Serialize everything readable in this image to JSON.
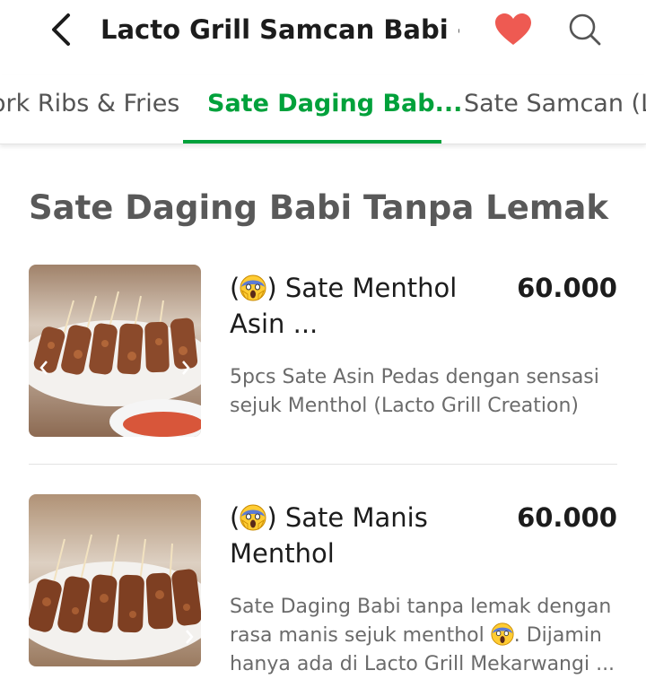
{
  "header": {
    "title": "Lacto Grill Samcan Babi -...",
    "back_icon": "chevron-left-icon",
    "favorite_icon": "heart-icon",
    "search_icon": "search-icon",
    "favorite_color": "#ee5a52"
  },
  "tabs": [
    {
      "label": "ork Ribs & Fries",
      "active": false
    },
    {
      "label": "Sate Daging Bab...",
      "active": true
    },
    {
      "label": "Sate Samcan (La",
      "active": false
    }
  ],
  "accent_color": "#00a13b",
  "section": {
    "title": "Sate Daging Babi Tanpa Lemak"
  },
  "items": [
    {
      "emoji": "screaming-face-icon",
      "open": "(",
      "close": ") ",
      "name_rest": "Sate Menthol Asin ...",
      "price": "60.000",
      "description": "5pcs Sate Asin Pedas dengan sensasi sejuk Menthol (Lacto Grill Creation)"
    },
    {
      "emoji": "screaming-face-icon",
      "open": "(",
      "close": ") ",
      "name_rest": "Sate Manis Menthol",
      "price": "60.000",
      "description_part1": "Sate Daging Babi tanpa lemak dengan rasa manis sejuk menthol ",
      "description_part2": ".  Dijamin hanya ada di Lacto Grill Mekarwangi ..."
    }
  ]
}
